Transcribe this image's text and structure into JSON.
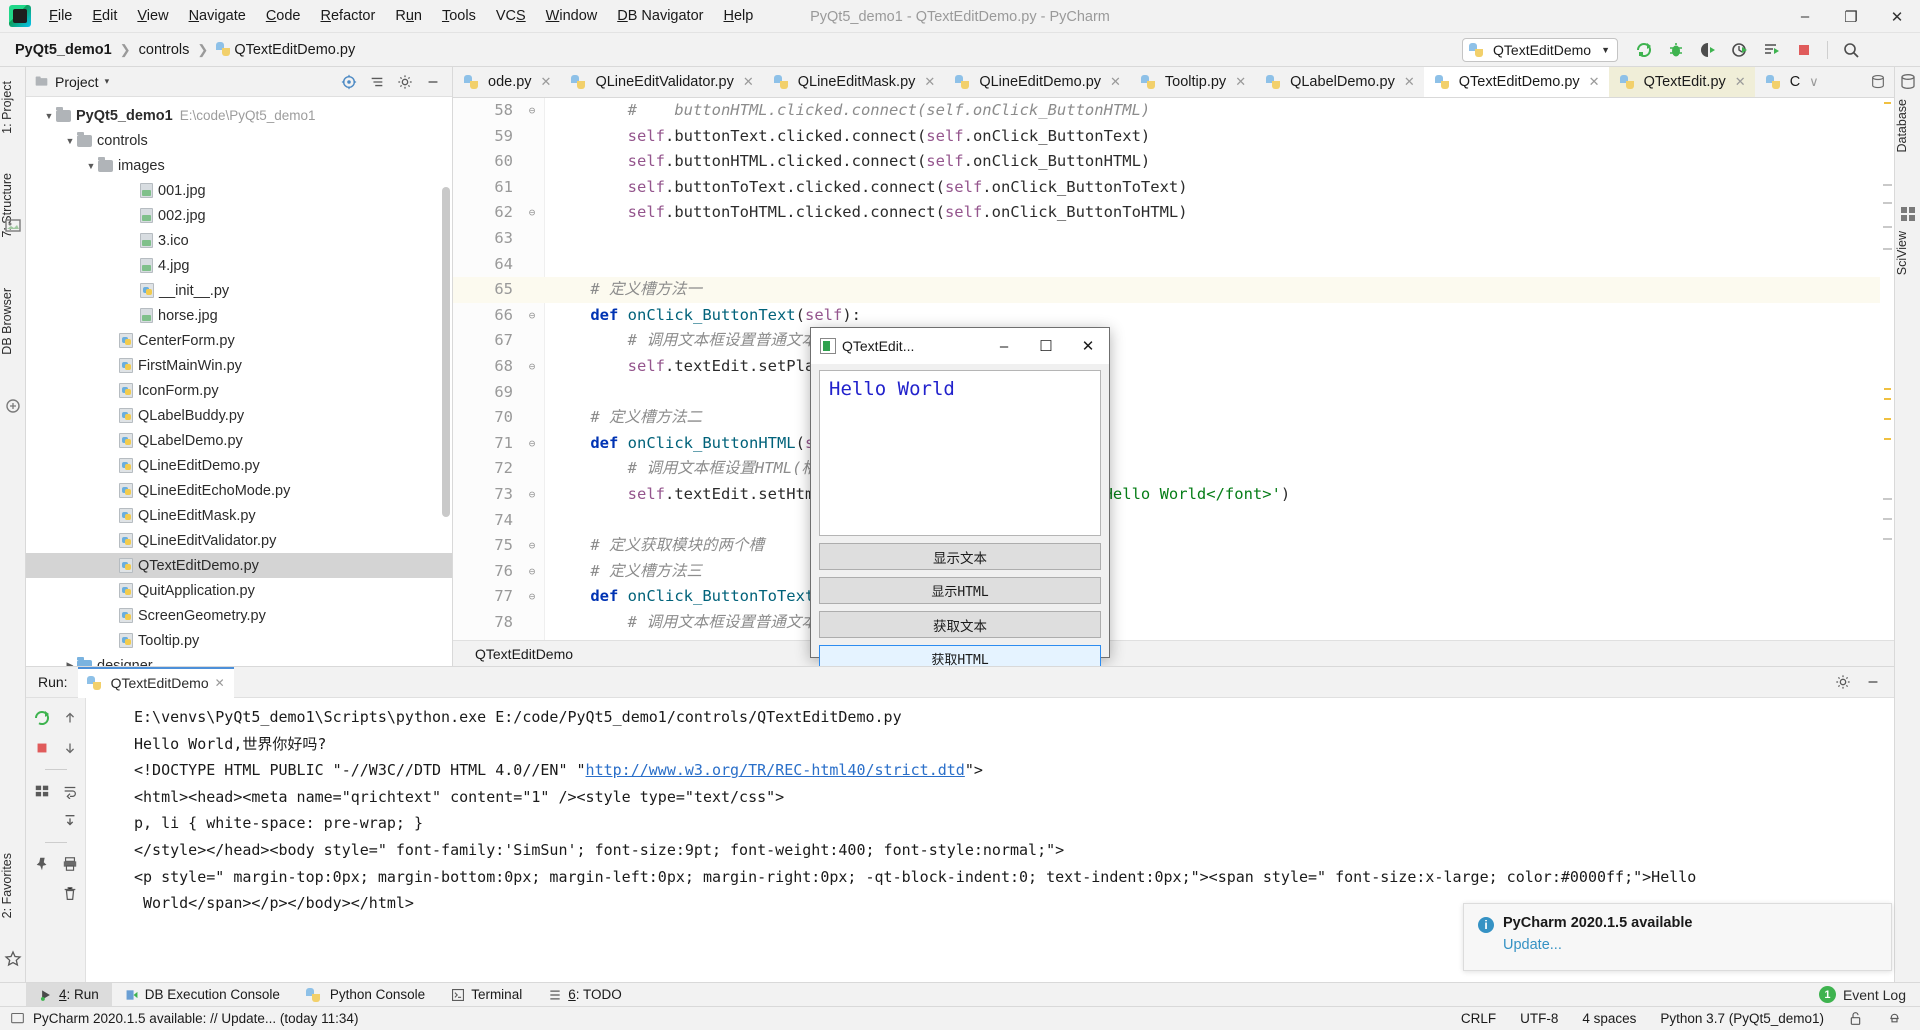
{
  "window": {
    "title": "PyQt5_demo1 - QTextEditDemo.py - PyCharm",
    "minimize": "–",
    "maximize": "❐",
    "close": "✕"
  },
  "menu": [
    {
      "label": "File"
    },
    {
      "label": "Edit"
    },
    {
      "label": "View"
    },
    {
      "label": "Navigate"
    },
    {
      "label": "Code"
    },
    {
      "label": "Refactor"
    },
    {
      "label": "Run"
    },
    {
      "label": "Tools"
    },
    {
      "label": "VCS"
    },
    {
      "label": "Window"
    },
    {
      "label": "DB Navigator"
    },
    {
      "label": "Help"
    }
  ],
  "breadcrumbs": [
    {
      "label": "PyQt5_demo1"
    },
    {
      "label": "controls"
    },
    {
      "label": "QTextEditDemo.py"
    }
  ],
  "run_config": {
    "name": "QTextEditDemo",
    "caret": "▼"
  },
  "left_strip": [
    {
      "label": "1: Project"
    },
    {
      "label": "7: Structure"
    },
    {
      "label": "DB Browser"
    }
  ],
  "right_strip": [
    {
      "label": "Database"
    },
    {
      "label": "SciView"
    }
  ],
  "project_panel": {
    "title": "Project",
    "caret": "▾",
    "tree": [
      {
        "depth": 0,
        "arrow": "▼",
        "icon": "folder",
        "label": "PyQt5_demo1",
        "bold": true,
        "path": "E:\\code\\PyQt5_demo1",
        "selected": false
      },
      {
        "depth": 1,
        "arrow": "▼",
        "icon": "folder",
        "label": "controls",
        "bold": false,
        "path": "",
        "selected": false
      },
      {
        "depth": 2,
        "arrow": "▼",
        "icon": "folder",
        "label": "images",
        "bold": false,
        "path": "",
        "selected": false
      },
      {
        "depth": 4,
        "arrow": "",
        "icon": "image",
        "label": "001.jpg",
        "bold": false,
        "path": "",
        "selected": false
      },
      {
        "depth": 4,
        "arrow": "",
        "icon": "image",
        "label": "002.jpg",
        "bold": false,
        "path": "",
        "selected": false
      },
      {
        "depth": 4,
        "arrow": "",
        "icon": "image",
        "label": "3.ico",
        "bold": false,
        "path": "",
        "selected": false
      },
      {
        "depth": 4,
        "arrow": "",
        "icon": "image",
        "label": "4.jpg",
        "bold": false,
        "path": "",
        "selected": false
      },
      {
        "depth": 4,
        "arrow": "",
        "icon": "python",
        "label": "__init__.py",
        "bold": false,
        "path": "",
        "selected": false
      },
      {
        "depth": 4,
        "arrow": "",
        "icon": "image",
        "label": "horse.jpg",
        "bold": false,
        "path": "",
        "selected": false
      },
      {
        "depth": 3,
        "arrow": "",
        "icon": "python",
        "label": "CenterForm.py",
        "bold": false,
        "path": "",
        "selected": false
      },
      {
        "depth": 3,
        "arrow": "",
        "icon": "python",
        "label": "FirstMainWin.py",
        "bold": false,
        "path": "",
        "selected": false
      },
      {
        "depth": 3,
        "arrow": "",
        "icon": "python",
        "label": "IconForm.py",
        "bold": false,
        "path": "",
        "selected": false
      },
      {
        "depth": 3,
        "arrow": "",
        "icon": "python",
        "label": "QLabelBuddy.py",
        "bold": false,
        "path": "",
        "selected": false
      },
      {
        "depth": 3,
        "arrow": "",
        "icon": "python",
        "label": "QLabelDemo.py",
        "bold": false,
        "path": "",
        "selected": false
      },
      {
        "depth": 3,
        "arrow": "",
        "icon": "python",
        "label": "QLineEditDemo.py",
        "bold": false,
        "path": "",
        "selected": false
      },
      {
        "depth": 3,
        "arrow": "",
        "icon": "python",
        "label": "QLineEditEchoMode.py",
        "bold": false,
        "path": "",
        "selected": false
      },
      {
        "depth": 3,
        "arrow": "",
        "icon": "python",
        "label": "QLineEditMask.py",
        "bold": false,
        "path": "",
        "selected": false
      },
      {
        "depth": 3,
        "arrow": "",
        "icon": "python",
        "label": "QLineEditValidator.py",
        "bold": false,
        "path": "",
        "selected": false
      },
      {
        "depth": 3,
        "arrow": "",
        "icon": "python",
        "label": "QTextEditDemo.py",
        "bold": false,
        "path": "",
        "selected": true
      },
      {
        "depth": 3,
        "arrow": "",
        "icon": "python",
        "label": "QuitApplication.py",
        "bold": false,
        "path": "",
        "selected": false
      },
      {
        "depth": 3,
        "arrow": "",
        "icon": "python",
        "label": "ScreenGeometry.py",
        "bold": false,
        "path": "",
        "selected": false
      },
      {
        "depth": 3,
        "arrow": "",
        "icon": "python",
        "label": "Tooltip.py",
        "bold": false,
        "path": "",
        "selected": false
      },
      {
        "depth": 1,
        "arrow": "▶",
        "icon": "folder-blue",
        "label": "designer",
        "bold": false,
        "path": "",
        "selected": false
      }
    ]
  },
  "editor": {
    "tabs": [
      {
        "label": "ode.py",
        "state": "partial",
        "close": "✕"
      },
      {
        "label": "QLineEditValidator.py",
        "state": "normal",
        "close": "✕"
      },
      {
        "label": "QLineEditMask.py",
        "state": "normal",
        "close": "✕"
      },
      {
        "label": "QLineEditDemo.py",
        "state": "normal",
        "close": "✕"
      },
      {
        "label": "Tooltip.py",
        "state": "normal",
        "close": "✕"
      },
      {
        "label": "QLabelDemo.py",
        "state": "normal",
        "close": "✕"
      },
      {
        "label": "QTextEditDemo.py",
        "state": "active",
        "close": "✕"
      },
      {
        "label": "QTextEdit.py",
        "state": "modified",
        "close": "✕"
      },
      {
        "label": "C",
        "state": "overflow",
        "close": "∨"
      }
    ],
    "breadcrumb": "QTextEditDemo",
    "lines": [
      {
        "no": "58",
        "fold": "⊖",
        "highlight": false
      },
      {
        "no": "59",
        "fold": "",
        "highlight": false
      },
      {
        "no": "60",
        "fold": "",
        "highlight": false
      },
      {
        "no": "61",
        "fold": "",
        "highlight": false
      },
      {
        "no": "62",
        "fold": "⊖",
        "highlight": false
      },
      {
        "no": "63",
        "fold": "",
        "highlight": false
      },
      {
        "no": "64",
        "fold": "",
        "highlight": false
      },
      {
        "no": "65",
        "fold": "",
        "highlight": true
      },
      {
        "no": "66",
        "fold": "⊖",
        "highlight": false
      },
      {
        "no": "67",
        "fold": "",
        "highlight": false
      },
      {
        "no": "68",
        "fold": "⊖",
        "highlight": false
      },
      {
        "no": "69",
        "fold": "",
        "highlight": false
      },
      {
        "no": "70",
        "fold": "",
        "highlight": false
      },
      {
        "no": "71",
        "fold": "⊖",
        "highlight": false
      },
      {
        "no": "72",
        "fold": "",
        "highlight": false
      },
      {
        "no": "73",
        "fold": "⊖",
        "highlight": false
      },
      {
        "no": "74",
        "fold": "",
        "highlight": false
      },
      {
        "no": "75",
        "fold": "⊖",
        "highlight": false
      },
      {
        "no": "76",
        "fold": "⊖",
        "highlight": false
      },
      {
        "no": "77",
        "fold": "⊖",
        "highlight": false
      },
      {
        "no": "78",
        "fold": "",
        "highlight": false
      }
    ],
    "code_text": [
      "#    buttonHTML.clicked.connect(self.onClick_ButtonHTML)",
      "self.buttonText.clicked.connect(self.onClick_ButtonText)",
      "self.buttonHTML.clicked.connect(self.onClick_ButtonHTML)",
      "self.buttonToText.clicked.connect(self.onClick_ButtonToText)",
      "self.buttonToHTML.clicked.connect(self.onClick_ButtonToHTML)",
      "",
      "",
      "# 定义槽方法一",
      "def onClick_ButtonText(self):",
      "# 调用文本框设置普通文本",
      "self.textEdit.setPlainText('Hello World,世界你好吗?')",
      "",
      "# 定义槽方法二",
      "def onClick_ButtonHTML(self):",
      "# 调用文本框设置HTML(格式化)",
      "self.textEdit.setHtml('<font color=\"blue\" size=\"5\">Hello World</font>')",
      "",
      "# 定义获取模块的两个槽",
      "# 定义槽方法三",
      "def onClick_ButtonToText(self):",
      "# 调用文本框设置普通文本"
    ]
  },
  "qt_dialog": {
    "title": "QTextEdit...",
    "minimize": "–",
    "maximize": "☐",
    "close": "✕",
    "content_text": "Hello World",
    "content_color": "#2222cc",
    "buttons": [
      {
        "label": "显示文本",
        "focused": false,
        "mono": false
      },
      {
        "label": "显示HTML",
        "focused": false,
        "mono": true
      },
      {
        "label": "获取文本",
        "focused": false,
        "mono": false
      },
      {
        "label": "获取HTML",
        "focused": true,
        "mono": true
      }
    ]
  },
  "run_panel": {
    "label": "Run:",
    "tab_name": "QTextEditDemo",
    "tab_close": "✕",
    "console_lines": [
      "E:\\venvs\\PyQt5_demo1\\Scripts\\python.exe E:/code/PyQt5_demo1/controls/QTextEditDemo.py",
      "Hello World,世界你好吗?",
      "<!DOCTYPE HTML PUBLIC \"-//W3C//DTD HTML 4.0//EN\" \"http://www.w3.org/TR/REC-html40/strict.dtd\">",
      "<html><head><meta name=\"qrichtext\" content=\"1\" /><style type=\"text/css\">",
      "p, li { white-space: pre-wrap; }",
      "</style></head><body style=\" font-family:'SimSun'; font-size:9pt; font-weight:400; font-style:normal;\">",
      "<p style=\" margin-top:0px; margin-bottom:0px; margin-left:0px; margin-right:0px; -qt-block-indent:0; text-indent:0px;\"><span style=\" font-size:x-large; color:#0000ff;\">Hello",
      " World</span></p></body></html>"
    ],
    "console_link": "http://www.w3.org/TR/REC-html40/strict.dtd"
  },
  "notification": {
    "title": "PyCharm 2020.1.5 available",
    "link": "Update...",
    "icon": "i"
  },
  "toolwindow_bar": {
    "items": [
      {
        "label": "4: Run",
        "key": "4",
        "active": true,
        "icon": "run-icon"
      },
      {
        "label": "DB Execution Console",
        "key": "",
        "active": false,
        "icon": "db-console-icon"
      },
      {
        "label": "Python Console",
        "key": "",
        "active": false,
        "icon": "python-console-icon"
      },
      {
        "label": "Terminal",
        "key": "",
        "active": false,
        "icon": "terminal-icon"
      },
      {
        "label": "6: TODO",
        "key": "6",
        "active": false,
        "icon": "todo-icon"
      }
    ],
    "event_log": {
      "label": "Event Log",
      "count": "1"
    }
  },
  "statusbar": {
    "message": "PyCharm 2020.1.5 available: // Update... (today 11:34)",
    "line_sep": "CRLF",
    "encoding": "UTF-8",
    "indent": "4 spaces",
    "interpreter": "Python 3.7 (PyQt5_demo1)"
  },
  "colors": {
    "accent": "#3592c4",
    "selection": "#d4d4d4",
    "highlight": "#fae9b5",
    "modified_tab": "#f0eed8",
    "keyword": "#0033b3",
    "string": "#067d17",
    "comment": "#8c8c8c",
    "self": "#94558d",
    "function": "#00627a",
    "link": "#2a6fc9",
    "green": "#3eb34f"
  }
}
